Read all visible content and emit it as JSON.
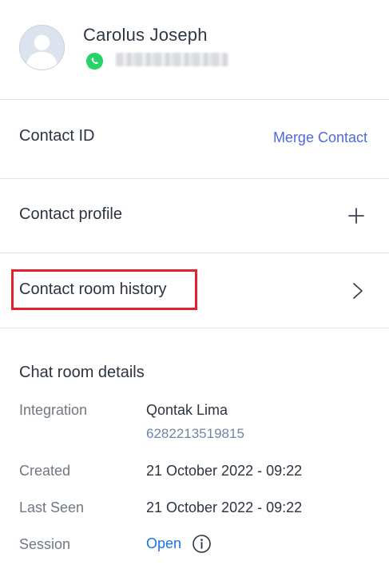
{
  "contact": {
    "name": "Carolus Joseph",
    "channel_icon": "whatsapp-icon",
    "avatar_icon": "user-avatar-icon"
  },
  "contact_id": {
    "title": "Contact ID",
    "merge_label": "Merge Contact"
  },
  "contact_profile": {
    "title": "Contact profile",
    "action_icon": "plus-icon"
  },
  "contact_room_history": {
    "title": "Contact room history",
    "action_icon": "chevron-right-icon",
    "highlight_color": "#e3202c"
  },
  "chat_room_details": {
    "title": "Chat room details",
    "integration_label": "Integration",
    "integration_value": "Qontak Lima",
    "integration_phone": "6282213519815",
    "created_label": "Created",
    "created_value": "21 October 2022 - 09:22",
    "last_seen_label": "Last Seen",
    "last_seen_value": "21 October 2022 - 09:22",
    "session_label": "Session",
    "session_value": "Open",
    "session_info_icon": "info-icon"
  },
  "colors": {
    "link": "#4f6ad8",
    "session_open": "#1a73e8",
    "whatsapp": "#25d366"
  }
}
